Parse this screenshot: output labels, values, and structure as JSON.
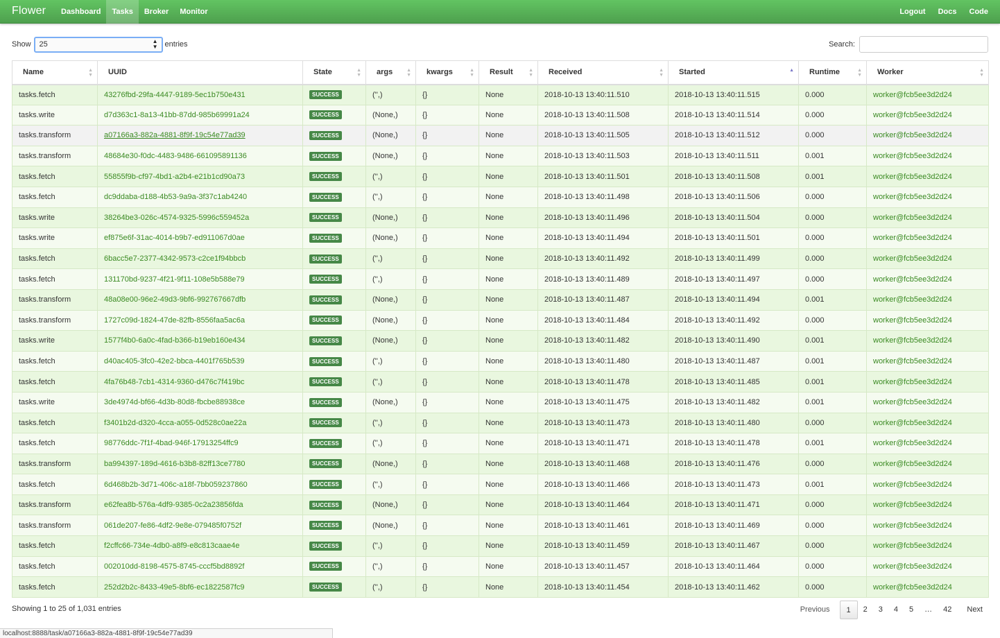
{
  "nav": {
    "brand": "Flower",
    "links": [
      "Dashboard",
      "Tasks",
      "Broker",
      "Monitor"
    ],
    "right_links": [
      "Logout",
      "Docs",
      "Code"
    ]
  },
  "controls": {
    "show_label": "Show",
    "length_value": "25",
    "entries_label": "entries",
    "search_label": "Search:",
    "search_value": ""
  },
  "table": {
    "columns": [
      "Name",
      "UUID",
      "State",
      "args",
      "kwargs",
      "Result",
      "Received",
      "Started",
      "Runtime",
      "Worker"
    ],
    "sorted_column": "Started",
    "rows": [
      {
        "name": "tasks.fetch",
        "uuid": "43276fbd-29fa-4447-9189-5ec1b750e431",
        "state": "SUCCESS",
        "args": "('',)",
        "kwargs": "{}",
        "result": "None",
        "received": "2018-10-13 13:40:11.510",
        "started": "2018-10-13 13:40:11.515",
        "runtime": "0.000",
        "worker": "worker@fcb5ee3d2d24"
      },
      {
        "name": "tasks.write",
        "uuid": "d7d363c1-8a13-41bb-87dd-985b69991a24",
        "state": "SUCCESS",
        "args": "(None,)",
        "kwargs": "{}",
        "result": "None",
        "received": "2018-10-13 13:40:11.508",
        "started": "2018-10-13 13:40:11.514",
        "runtime": "0.000",
        "worker": "worker@fcb5ee3d2d24"
      },
      {
        "name": "tasks.transform",
        "uuid": "a07166a3-882a-4881-8f9f-19c54e77ad39",
        "state": "SUCCESS",
        "args": "(None,)",
        "kwargs": "{}",
        "result": "None",
        "received": "2018-10-13 13:40:11.505",
        "started": "2018-10-13 13:40:11.512",
        "runtime": "0.000",
        "worker": "worker@fcb5ee3d2d24"
      },
      {
        "name": "tasks.transform",
        "uuid": "48684e30-f0dc-4483-9486-661095891136",
        "state": "SUCCESS",
        "args": "(None,)",
        "kwargs": "{}",
        "result": "None",
        "received": "2018-10-13 13:40:11.503",
        "started": "2018-10-13 13:40:11.511",
        "runtime": "0.001",
        "worker": "worker@fcb5ee3d2d24"
      },
      {
        "name": "tasks.fetch",
        "uuid": "55855f9b-cf97-4bd1-a2b4-e21b1cd90a73",
        "state": "SUCCESS",
        "args": "('',)",
        "kwargs": "{}",
        "result": "None",
        "received": "2018-10-13 13:40:11.501",
        "started": "2018-10-13 13:40:11.508",
        "runtime": "0.001",
        "worker": "worker@fcb5ee3d2d24"
      },
      {
        "name": "tasks.fetch",
        "uuid": "dc9ddaba-d188-4b53-9a9a-3f37c1ab4240",
        "state": "SUCCESS",
        "args": "('',)",
        "kwargs": "{}",
        "result": "None",
        "received": "2018-10-13 13:40:11.498",
        "started": "2018-10-13 13:40:11.506",
        "runtime": "0.000",
        "worker": "worker@fcb5ee3d2d24"
      },
      {
        "name": "tasks.write",
        "uuid": "38264be3-026c-4574-9325-5996c559452a",
        "state": "SUCCESS",
        "args": "(None,)",
        "kwargs": "{}",
        "result": "None",
        "received": "2018-10-13 13:40:11.496",
        "started": "2018-10-13 13:40:11.504",
        "runtime": "0.000",
        "worker": "worker@fcb5ee3d2d24"
      },
      {
        "name": "tasks.write",
        "uuid": "ef875e6f-31ac-4014-b9b7-ed911067d0ae",
        "state": "SUCCESS",
        "args": "(None,)",
        "kwargs": "{}",
        "result": "None",
        "received": "2018-10-13 13:40:11.494",
        "started": "2018-10-13 13:40:11.501",
        "runtime": "0.000",
        "worker": "worker@fcb5ee3d2d24"
      },
      {
        "name": "tasks.fetch",
        "uuid": "6bacc5e7-2377-4342-9573-c2ce1f94bbcb",
        "state": "SUCCESS",
        "args": "('',)",
        "kwargs": "{}",
        "result": "None",
        "received": "2018-10-13 13:40:11.492",
        "started": "2018-10-13 13:40:11.499",
        "runtime": "0.000",
        "worker": "worker@fcb5ee3d2d24"
      },
      {
        "name": "tasks.fetch",
        "uuid": "131170bd-9237-4f21-9f11-108e5b588e79",
        "state": "SUCCESS",
        "args": "('',)",
        "kwargs": "{}",
        "result": "None",
        "received": "2018-10-13 13:40:11.489",
        "started": "2018-10-13 13:40:11.497",
        "runtime": "0.000",
        "worker": "worker@fcb5ee3d2d24"
      },
      {
        "name": "tasks.transform",
        "uuid": "48a08e00-96e2-49d3-9bf6-992767667dfb",
        "state": "SUCCESS",
        "args": "(None,)",
        "kwargs": "{}",
        "result": "None",
        "received": "2018-10-13 13:40:11.487",
        "started": "2018-10-13 13:40:11.494",
        "runtime": "0.001",
        "worker": "worker@fcb5ee3d2d24"
      },
      {
        "name": "tasks.transform",
        "uuid": "1727c09d-1824-47de-82fb-8556faa5ac6a",
        "state": "SUCCESS",
        "args": "(None,)",
        "kwargs": "{}",
        "result": "None",
        "received": "2018-10-13 13:40:11.484",
        "started": "2018-10-13 13:40:11.492",
        "runtime": "0.000",
        "worker": "worker@fcb5ee3d2d24"
      },
      {
        "name": "tasks.write",
        "uuid": "1577f4b0-6a0c-4fad-b366-b19eb160e434",
        "state": "SUCCESS",
        "args": "(None,)",
        "kwargs": "{}",
        "result": "None",
        "received": "2018-10-13 13:40:11.482",
        "started": "2018-10-13 13:40:11.490",
        "runtime": "0.001",
        "worker": "worker@fcb5ee3d2d24"
      },
      {
        "name": "tasks.fetch",
        "uuid": "d40ac405-3fc0-42e2-bbca-4401f765b539",
        "state": "SUCCESS",
        "args": "('',)",
        "kwargs": "{}",
        "result": "None",
        "received": "2018-10-13 13:40:11.480",
        "started": "2018-10-13 13:40:11.487",
        "runtime": "0.001",
        "worker": "worker@fcb5ee3d2d24"
      },
      {
        "name": "tasks.fetch",
        "uuid": "4fa76b48-7cb1-4314-9360-d476c7f419bc",
        "state": "SUCCESS",
        "args": "('',)",
        "kwargs": "{}",
        "result": "None",
        "received": "2018-10-13 13:40:11.478",
        "started": "2018-10-13 13:40:11.485",
        "runtime": "0.001",
        "worker": "worker@fcb5ee3d2d24"
      },
      {
        "name": "tasks.write",
        "uuid": "3de4974d-bf66-4d3b-80d8-fbcbe88938ce",
        "state": "SUCCESS",
        "args": "(None,)",
        "kwargs": "{}",
        "result": "None",
        "received": "2018-10-13 13:40:11.475",
        "started": "2018-10-13 13:40:11.482",
        "runtime": "0.001",
        "worker": "worker@fcb5ee3d2d24"
      },
      {
        "name": "tasks.fetch",
        "uuid": "f3401b2d-d320-4cca-a055-0d528c0ae22a",
        "state": "SUCCESS",
        "args": "('',)",
        "kwargs": "{}",
        "result": "None",
        "received": "2018-10-13 13:40:11.473",
        "started": "2018-10-13 13:40:11.480",
        "runtime": "0.000",
        "worker": "worker@fcb5ee3d2d24"
      },
      {
        "name": "tasks.fetch",
        "uuid": "98776ddc-7f1f-4bad-946f-17913254ffc9",
        "state": "SUCCESS",
        "args": "('',)",
        "kwargs": "{}",
        "result": "None",
        "received": "2018-10-13 13:40:11.471",
        "started": "2018-10-13 13:40:11.478",
        "runtime": "0.001",
        "worker": "worker@fcb5ee3d2d24"
      },
      {
        "name": "tasks.transform",
        "uuid": "ba994397-189d-4616-b3b8-82ff13ce7780",
        "state": "SUCCESS",
        "args": "(None,)",
        "kwargs": "{}",
        "result": "None",
        "received": "2018-10-13 13:40:11.468",
        "started": "2018-10-13 13:40:11.476",
        "runtime": "0.000",
        "worker": "worker@fcb5ee3d2d24"
      },
      {
        "name": "tasks.fetch",
        "uuid": "6d468b2b-3d71-406c-a18f-7bb059237860",
        "state": "SUCCESS",
        "args": "('',)",
        "kwargs": "{}",
        "result": "None",
        "received": "2018-10-13 13:40:11.466",
        "started": "2018-10-13 13:40:11.473",
        "runtime": "0.001",
        "worker": "worker@fcb5ee3d2d24"
      },
      {
        "name": "tasks.transform",
        "uuid": "e62fea8b-576a-4df9-9385-0c2a23856fda",
        "state": "SUCCESS",
        "args": "(None,)",
        "kwargs": "{}",
        "result": "None",
        "received": "2018-10-13 13:40:11.464",
        "started": "2018-10-13 13:40:11.471",
        "runtime": "0.000",
        "worker": "worker@fcb5ee3d2d24"
      },
      {
        "name": "tasks.transform",
        "uuid": "061de207-fe86-4df2-9e8e-079485f0752f",
        "state": "SUCCESS",
        "args": "(None,)",
        "kwargs": "{}",
        "result": "None",
        "received": "2018-10-13 13:40:11.461",
        "started": "2018-10-13 13:40:11.469",
        "runtime": "0.000",
        "worker": "worker@fcb5ee3d2d24"
      },
      {
        "name": "tasks.fetch",
        "uuid": "f2cffc66-734e-4db0-a8f9-e8c813caae4e",
        "state": "SUCCESS",
        "args": "('',)",
        "kwargs": "{}",
        "result": "None",
        "received": "2018-10-13 13:40:11.459",
        "started": "2018-10-13 13:40:11.467",
        "runtime": "0.000",
        "worker": "worker@fcb5ee3d2d24"
      },
      {
        "name": "tasks.fetch",
        "uuid": "002010dd-8198-4575-8745-cccf5bd8892f",
        "state": "SUCCESS",
        "args": "('',)",
        "kwargs": "{}",
        "result": "None",
        "received": "2018-10-13 13:40:11.457",
        "started": "2018-10-13 13:40:11.464",
        "runtime": "0.000",
        "worker": "worker@fcb5ee3d2d24"
      },
      {
        "name": "tasks.fetch",
        "uuid": "252d2b2c-8433-49e5-8bf6-ec1822587fc9",
        "state": "SUCCESS",
        "args": "('',)",
        "kwargs": "{}",
        "result": "None",
        "received": "2018-10-13 13:40:11.454",
        "started": "2018-10-13 13:40:11.462",
        "runtime": "0.000",
        "worker": "worker@fcb5ee3d2d24"
      }
    ]
  },
  "footer": {
    "info": "Showing 1 to 25 of 1,031 entries",
    "pagination": [
      "Previous",
      "1",
      "2",
      "3",
      "4",
      "5",
      "…",
      "42",
      "Next"
    ],
    "current_page": "1"
  },
  "statusbar": {
    "url": "localhost:8888/task/a07166a3-882a-4881-8f9f-19c54e77ad39"
  },
  "colors": {
    "navbar": "#4ea04e",
    "success_badge": "#468847",
    "link_green": "#3a8a22",
    "row_bg": "#e9f7df"
  }
}
